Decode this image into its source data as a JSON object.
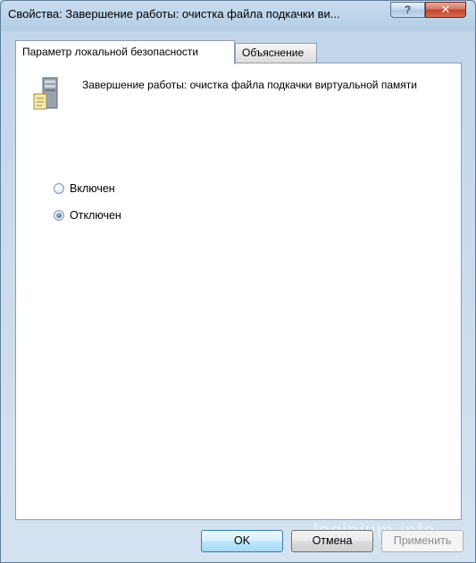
{
  "window": {
    "title": "Свойства: Завершение работы: очистка файла подкачки ви...",
    "help_label": "?",
    "close_label": "✕"
  },
  "tabs": [
    {
      "label": "Параметр локальной безопасности",
      "active": true
    },
    {
      "label": "Объяснение",
      "active": false
    }
  ],
  "policy": {
    "icon": "server-policy-icon",
    "title": "Завершение работы: очистка файла подкачки виртуальной памяти"
  },
  "options": [
    {
      "label": "Включен",
      "checked": false
    },
    {
      "label": "Отключен",
      "checked": true
    }
  ],
  "buttons": {
    "ok": "OK",
    "cancel": "Отмена",
    "apply": "Применить"
  },
  "watermark": "loginium.info"
}
